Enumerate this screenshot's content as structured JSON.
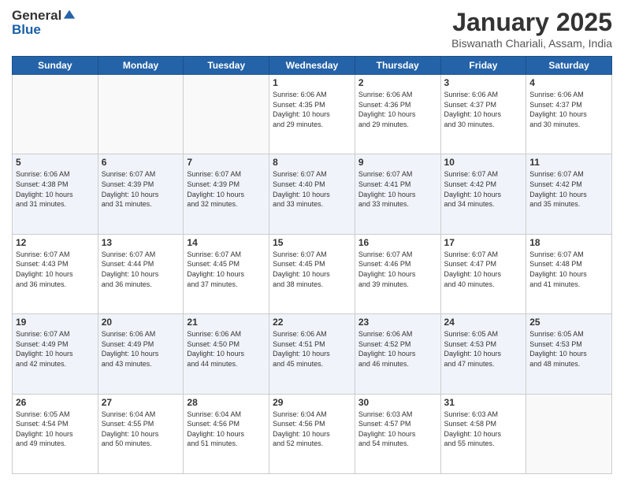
{
  "header": {
    "logo_line1": "General",
    "logo_line2": "Blue",
    "month": "January 2025",
    "location": "Biswanath Chariali, Assam, India"
  },
  "weekdays": [
    "Sunday",
    "Monday",
    "Tuesday",
    "Wednesday",
    "Thursday",
    "Friday",
    "Saturday"
  ],
  "weeks": [
    [
      {
        "day": "",
        "info": ""
      },
      {
        "day": "",
        "info": ""
      },
      {
        "day": "",
        "info": ""
      },
      {
        "day": "1",
        "info": "Sunrise: 6:06 AM\nSunset: 4:35 PM\nDaylight: 10 hours\nand 29 minutes."
      },
      {
        "day": "2",
        "info": "Sunrise: 6:06 AM\nSunset: 4:36 PM\nDaylight: 10 hours\nand 29 minutes."
      },
      {
        "day": "3",
        "info": "Sunrise: 6:06 AM\nSunset: 4:37 PM\nDaylight: 10 hours\nand 30 minutes."
      },
      {
        "day": "4",
        "info": "Sunrise: 6:06 AM\nSunset: 4:37 PM\nDaylight: 10 hours\nand 30 minutes."
      }
    ],
    [
      {
        "day": "5",
        "info": "Sunrise: 6:06 AM\nSunset: 4:38 PM\nDaylight: 10 hours\nand 31 minutes."
      },
      {
        "day": "6",
        "info": "Sunrise: 6:07 AM\nSunset: 4:39 PM\nDaylight: 10 hours\nand 31 minutes."
      },
      {
        "day": "7",
        "info": "Sunrise: 6:07 AM\nSunset: 4:39 PM\nDaylight: 10 hours\nand 32 minutes."
      },
      {
        "day": "8",
        "info": "Sunrise: 6:07 AM\nSunset: 4:40 PM\nDaylight: 10 hours\nand 33 minutes."
      },
      {
        "day": "9",
        "info": "Sunrise: 6:07 AM\nSunset: 4:41 PM\nDaylight: 10 hours\nand 33 minutes."
      },
      {
        "day": "10",
        "info": "Sunrise: 6:07 AM\nSunset: 4:42 PM\nDaylight: 10 hours\nand 34 minutes."
      },
      {
        "day": "11",
        "info": "Sunrise: 6:07 AM\nSunset: 4:42 PM\nDaylight: 10 hours\nand 35 minutes."
      }
    ],
    [
      {
        "day": "12",
        "info": "Sunrise: 6:07 AM\nSunset: 4:43 PM\nDaylight: 10 hours\nand 36 minutes."
      },
      {
        "day": "13",
        "info": "Sunrise: 6:07 AM\nSunset: 4:44 PM\nDaylight: 10 hours\nand 36 minutes."
      },
      {
        "day": "14",
        "info": "Sunrise: 6:07 AM\nSunset: 4:45 PM\nDaylight: 10 hours\nand 37 minutes."
      },
      {
        "day": "15",
        "info": "Sunrise: 6:07 AM\nSunset: 4:45 PM\nDaylight: 10 hours\nand 38 minutes."
      },
      {
        "day": "16",
        "info": "Sunrise: 6:07 AM\nSunset: 4:46 PM\nDaylight: 10 hours\nand 39 minutes."
      },
      {
        "day": "17",
        "info": "Sunrise: 6:07 AM\nSunset: 4:47 PM\nDaylight: 10 hours\nand 40 minutes."
      },
      {
        "day": "18",
        "info": "Sunrise: 6:07 AM\nSunset: 4:48 PM\nDaylight: 10 hours\nand 41 minutes."
      }
    ],
    [
      {
        "day": "19",
        "info": "Sunrise: 6:07 AM\nSunset: 4:49 PM\nDaylight: 10 hours\nand 42 minutes."
      },
      {
        "day": "20",
        "info": "Sunrise: 6:06 AM\nSunset: 4:49 PM\nDaylight: 10 hours\nand 43 minutes."
      },
      {
        "day": "21",
        "info": "Sunrise: 6:06 AM\nSunset: 4:50 PM\nDaylight: 10 hours\nand 44 minutes."
      },
      {
        "day": "22",
        "info": "Sunrise: 6:06 AM\nSunset: 4:51 PM\nDaylight: 10 hours\nand 45 minutes."
      },
      {
        "day": "23",
        "info": "Sunrise: 6:06 AM\nSunset: 4:52 PM\nDaylight: 10 hours\nand 46 minutes."
      },
      {
        "day": "24",
        "info": "Sunrise: 6:05 AM\nSunset: 4:53 PM\nDaylight: 10 hours\nand 47 minutes."
      },
      {
        "day": "25",
        "info": "Sunrise: 6:05 AM\nSunset: 4:53 PM\nDaylight: 10 hours\nand 48 minutes."
      }
    ],
    [
      {
        "day": "26",
        "info": "Sunrise: 6:05 AM\nSunset: 4:54 PM\nDaylight: 10 hours\nand 49 minutes."
      },
      {
        "day": "27",
        "info": "Sunrise: 6:04 AM\nSunset: 4:55 PM\nDaylight: 10 hours\nand 50 minutes."
      },
      {
        "day": "28",
        "info": "Sunrise: 6:04 AM\nSunset: 4:56 PM\nDaylight: 10 hours\nand 51 minutes."
      },
      {
        "day": "29",
        "info": "Sunrise: 6:04 AM\nSunset: 4:56 PM\nDaylight: 10 hours\nand 52 minutes."
      },
      {
        "day": "30",
        "info": "Sunrise: 6:03 AM\nSunset: 4:57 PM\nDaylight: 10 hours\nand 54 minutes."
      },
      {
        "day": "31",
        "info": "Sunrise: 6:03 AM\nSunset: 4:58 PM\nDaylight: 10 hours\nand 55 minutes."
      },
      {
        "day": "",
        "info": ""
      }
    ]
  ]
}
